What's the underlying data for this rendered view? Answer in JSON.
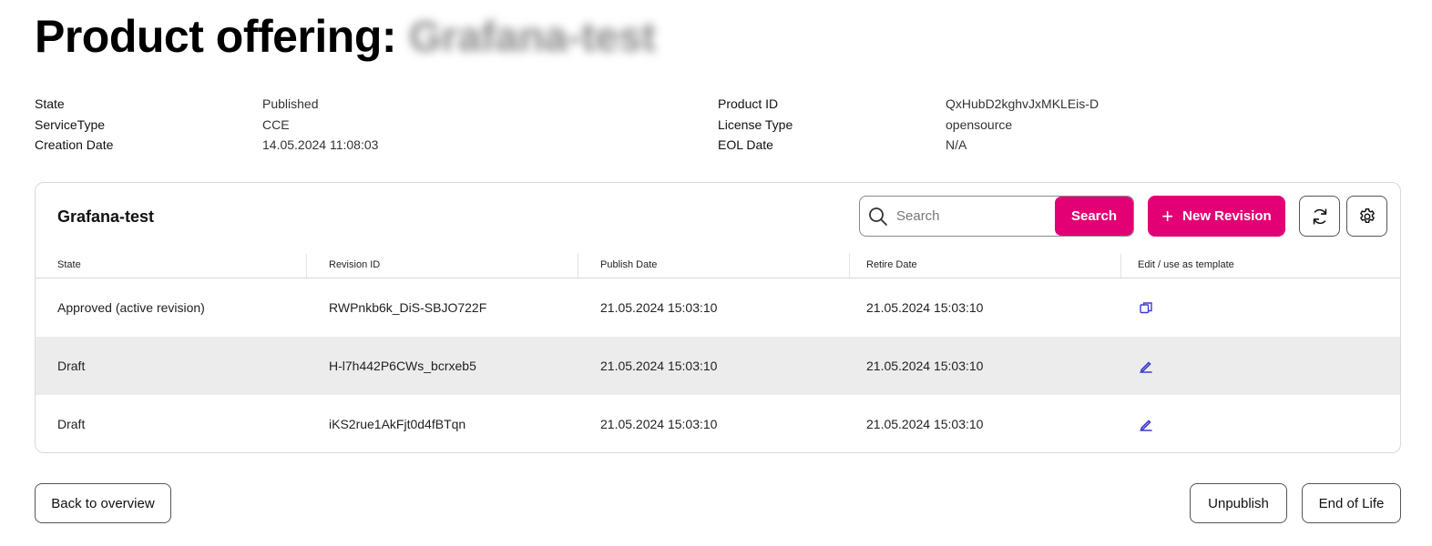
{
  "header": {
    "title_prefix": "Product offering:",
    "title_redacted": "Grafana-test"
  },
  "meta_left": [
    {
      "label": "State",
      "value": "Published"
    },
    {
      "label": "ServiceType",
      "value": "CCE"
    },
    {
      "label": "Creation Date",
      "value": "14.05.2024 11:08:03"
    }
  ],
  "meta_right": [
    {
      "label": "Product ID",
      "value": "QxHubD2kghvJxMKLEis-D"
    },
    {
      "label": "License Type",
      "value": "opensource"
    },
    {
      "label": "EOL Date",
      "value": "N/A"
    }
  ],
  "card": {
    "title": "Grafana-test",
    "search": {
      "placeholder": "Search",
      "value": "",
      "button_label": "Search"
    },
    "new_revision_label": "New Revision",
    "columns": [
      "State",
      "Revision ID",
      "Publish Date",
      "Retire Date",
      "Edit / use as template"
    ],
    "rows": [
      {
        "state": "Approved (active revision)",
        "revision_id": "RWPnkb6k_DiS-SBJO722F",
        "publish_date": "21.05.2024 15:03:10",
        "retire_date": "21.05.2024 15:03:10",
        "action_icon": "copy-icon"
      },
      {
        "state": "Draft",
        "revision_id": "H-l7h442P6CWs_bcrxeb5",
        "publish_date": "21.05.2024 15:03:10",
        "retire_date": "21.05.2024 15:03:10",
        "action_icon": "edit-icon"
      },
      {
        "state": "Draft",
        "revision_id": "iKS2rue1AkFjt0d4fBTqn",
        "publish_date": "21.05.2024 15:03:10",
        "retire_date": "21.05.2024 15:03:10",
        "action_icon": "edit-icon"
      }
    ]
  },
  "footer": {
    "back_label": "Back to overview",
    "unpublish_label": "Unpublish",
    "end_of_life_label": "End of Life"
  },
  "colors": {
    "accent": "#e20074",
    "icon_blue": "#3c3ccf",
    "row_alt": "#ececec"
  }
}
